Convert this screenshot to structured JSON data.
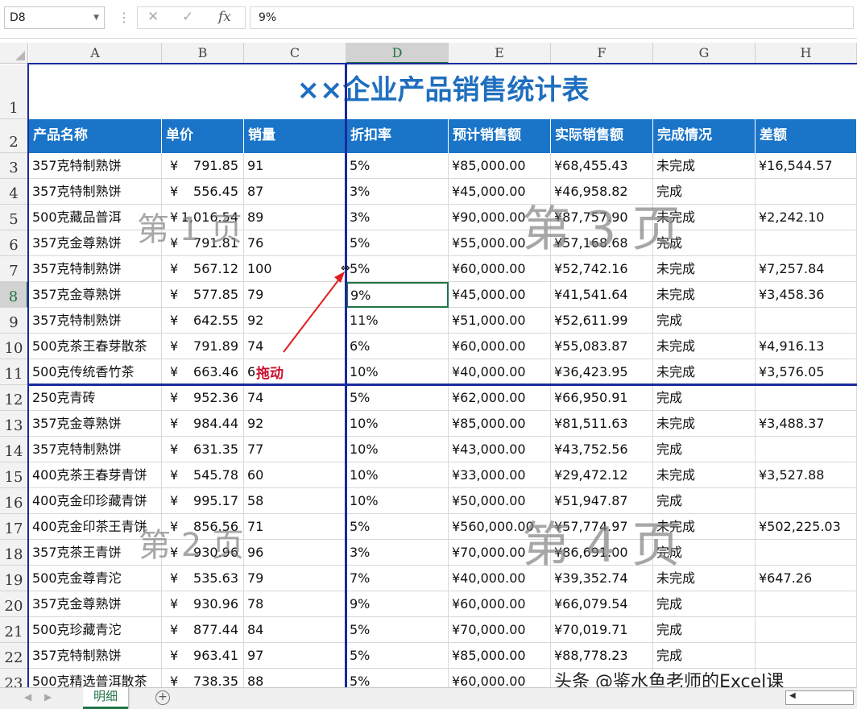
{
  "formula_bar": {
    "name_box": "D8",
    "cancel_icon": "✕",
    "enter_icon": "✓",
    "fx_label": "fx",
    "formula_value": "9%"
  },
  "columns": [
    "A",
    "B",
    "C",
    "D",
    "E",
    "F",
    "G",
    "H"
  ],
  "selected_column": "D",
  "selected_row": "8",
  "title": "××企业产品销售统计表",
  "headers": [
    "产品名称",
    "单价",
    "销量",
    "折扣率",
    "预计销售额",
    "实际销售额",
    "完成情况",
    "差额"
  ],
  "rows": [
    {
      "n": "3",
      "a": "357克特制熟饼",
      "c": "¥",
      "p": "791.85",
      "q": "91",
      "d": "5%",
      "e": "¥85,000.00",
      "f": "¥68,455.43",
      "g": "未完成",
      "h": "¥16,544.57"
    },
    {
      "n": "4",
      "a": "357克特制熟饼",
      "c": "¥",
      "p": "556.45",
      "q": "87",
      "d": "3%",
      "e": "¥45,000.00",
      "f": "¥46,958.82",
      "g": "完成",
      "h": ""
    },
    {
      "n": "5",
      "a": "500克藏品普洱",
      "c": "¥",
      "p": "1,016.54",
      "q": "89",
      "d": "3%",
      "e": "¥90,000.00",
      "f": "¥87,757.90",
      "g": "未完成",
      "h": "¥2,242.10"
    },
    {
      "n": "6",
      "a": "357克金尊熟饼",
      "c": "¥",
      "p": "791.81",
      "q": "76",
      "d": "5%",
      "e": "¥55,000.00",
      "f": "¥57,168.68",
      "g": "完成",
      "h": ""
    },
    {
      "n": "7",
      "a": "357克特制熟饼",
      "c": "¥",
      "p": "567.12",
      "q": "100",
      "d": "5%",
      "e": "¥60,000.00",
      "f": "¥52,742.16",
      "g": "未完成",
      "h": "¥7,257.84"
    },
    {
      "n": "8",
      "a": "357克金尊熟饼",
      "c": "¥",
      "p": "577.85",
      "q": "79",
      "d": "9%",
      "e": "¥45,000.00",
      "f": "¥41,541.64",
      "g": "未完成",
      "h": "¥3,458.36"
    },
    {
      "n": "9",
      "a": "357克特制熟饼",
      "c": "¥",
      "p": "642.55",
      "q": "92",
      "d": "11%",
      "e": "¥51,000.00",
      "f": "¥52,611.99",
      "g": "完成",
      "h": ""
    },
    {
      "n": "10",
      "a": "500克茶王春芽散茶",
      "c": "¥",
      "p": "791.89",
      "q": "74",
      "d": "6%",
      "e": "¥60,000.00",
      "f": "¥55,083.87",
      "g": "未完成",
      "h": "¥4,916.13"
    },
    {
      "n": "11",
      "a": "500克传统香竹茶",
      "c": "¥",
      "p": "663.46",
      "q": "6",
      "d": "10%",
      "e": "¥40,000.00",
      "f": "¥36,423.95",
      "g": "未完成",
      "h": "¥3,576.05"
    },
    {
      "n": "12",
      "a": "250克青砖",
      "c": "¥",
      "p": "952.36",
      "q": "74",
      "d": "5%",
      "e": "¥62,000.00",
      "f": "¥66,950.91",
      "g": "完成",
      "h": ""
    },
    {
      "n": "13",
      "a": "357克金尊熟饼",
      "c": "¥",
      "p": "984.44",
      "q": "92",
      "d": "10%",
      "e": "¥85,000.00",
      "f": "¥81,511.63",
      "g": "未完成",
      "h": "¥3,488.37"
    },
    {
      "n": "14",
      "a": "357克特制熟饼",
      "c": "¥",
      "p": "631.35",
      "q": "77",
      "d": "10%",
      "e": "¥43,000.00",
      "f": "¥43,752.56",
      "g": "完成",
      "h": ""
    },
    {
      "n": "15",
      "a": "400克茶王春芽青饼",
      "c": "¥",
      "p": "545.78",
      "q": "60",
      "d": "10%",
      "e": "¥33,000.00",
      "f": "¥29,472.12",
      "g": "未完成",
      "h": "¥3,527.88"
    },
    {
      "n": "16",
      "a": "400克金印珍藏青饼",
      "c": "¥",
      "p": "995.17",
      "q": "58",
      "d": "10%",
      "e": "¥50,000.00",
      "f": "¥51,947.87",
      "g": "完成",
      "h": ""
    },
    {
      "n": "17",
      "a": "400克金印茶王青饼",
      "c": "¥",
      "p": "856.56",
      "q": "71",
      "d": "5%",
      "e": "¥560,000.00",
      "f": "¥57,774.97",
      "g": "未完成",
      "h": "¥502,225.03"
    },
    {
      "n": "18",
      "a": "357克茶王青饼",
      "c": "¥",
      "p": "930.96",
      "q": "96",
      "d": "3%",
      "e": "¥70,000.00",
      "f": "¥86,691.00",
      "g": "完成",
      "h": ""
    },
    {
      "n": "19",
      "a": "500克金尊青沱",
      "c": "¥",
      "p": "535.63",
      "q": "79",
      "d": "7%",
      "e": "¥40,000.00",
      "f": "¥39,352.74",
      "g": "未完成",
      "h": "¥647.26"
    },
    {
      "n": "20",
      "a": "357克金尊熟饼",
      "c": "¥",
      "p": "930.96",
      "q": "78",
      "d": "9%",
      "e": "¥60,000.00",
      "f": "¥66,079.54",
      "g": "完成",
      "h": ""
    },
    {
      "n": "21",
      "a": "500克珍藏青沱",
      "c": "¥",
      "p": "877.44",
      "q": "84",
      "d": "5%",
      "e": "¥70,000.00",
      "f": "¥70,019.71",
      "g": "完成",
      "h": ""
    },
    {
      "n": "22",
      "a": "357克特制熟饼",
      "c": "¥",
      "p": "963.41",
      "q": "97",
      "d": "5%",
      "e": "¥85,000.00",
      "f": "¥88,778.23",
      "g": "完成",
      "h": ""
    },
    {
      "n": "23",
      "a": "500克精选普洱散茶",
      "c": "¥",
      "p": "738.35",
      "q": "88",
      "d": "5%",
      "e": "¥60,000.00",
      "f": "",
      "g": "",
      "h": ""
    }
  ],
  "page_watermarks": [
    "第 1 页",
    "第 3 页",
    "第 2 页",
    "第 4 页"
  ],
  "drag_label": "拖动",
  "sheet_tab": "明细",
  "credit": "头条 @鉴水鱼老师的Excel课",
  "colors": {
    "header_bg": "#1a74c8",
    "title": "#1f6fbf",
    "page_break": "#1a2aa0",
    "selection": "#217346",
    "annotation": "#c8102e"
  }
}
